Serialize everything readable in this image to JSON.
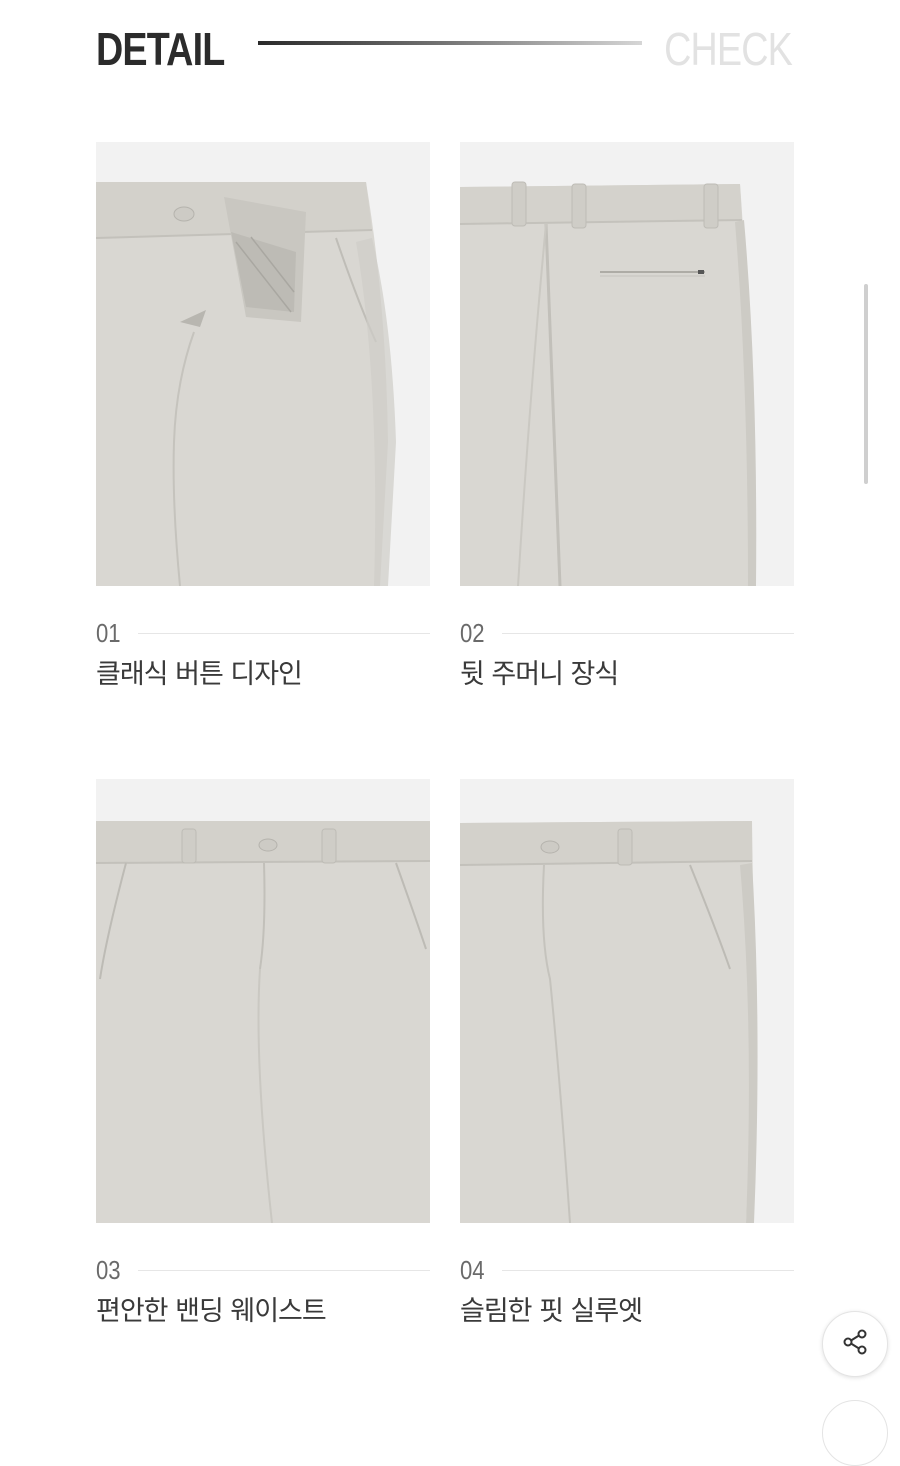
{
  "header": {
    "title": "DETAIL",
    "subtitle": "CHECK"
  },
  "details": [
    {
      "number": "01",
      "label": "클래식 버튼 디자인",
      "image": "pants-front-fly-closeup"
    },
    {
      "number": "02",
      "label": "뒷 주머니 장식",
      "image": "pants-back-pocket-closeup"
    },
    {
      "number": "03",
      "label": "편안한 밴딩 웨이스트",
      "image": "pants-front-waist-closeup"
    },
    {
      "number": "04",
      "label": "슬림한 핏 실루엣",
      "image": "pants-front-silhouette-closeup"
    }
  ],
  "share": {
    "icon": "share-icon"
  },
  "colors": {
    "fabric": "#d9d7d2",
    "background": "#f2f2f2",
    "title": "#2b2b2b",
    "subtitle": "#e2e2e2"
  }
}
